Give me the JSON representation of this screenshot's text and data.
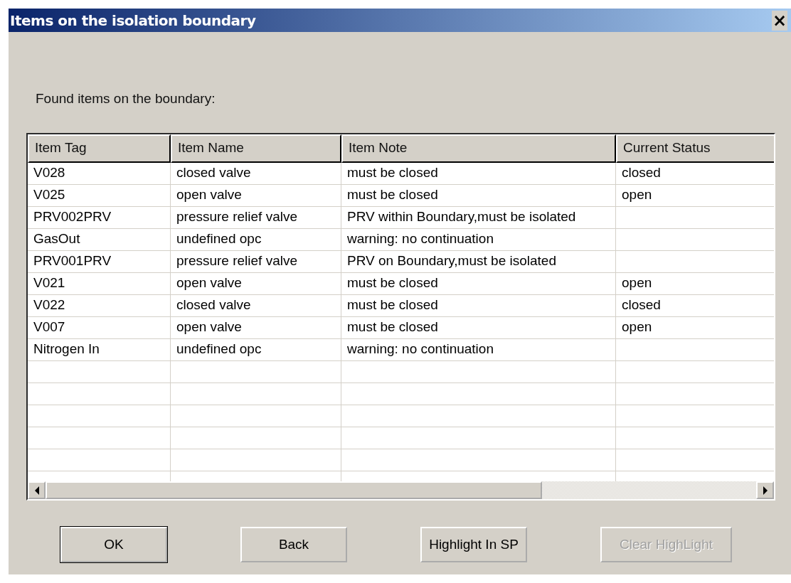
{
  "window": {
    "title": "Items on the isolation boundary",
    "close": "×"
  },
  "prompt": "Found items on the boundary:",
  "table": {
    "columns": [
      "Item Tag",
      "Item Name",
      "Item Note",
      "Current Status"
    ],
    "rows": [
      [
        "V028",
        "closed valve",
        "must be closed",
        "closed"
      ],
      [
        "V025",
        "open valve",
        "must be closed",
        "open"
      ],
      [
        "PRV002PRV",
        "pressure relief valve",
        "PRV within Boundary,must be isolated",
        ""
      ],
      [
        "GasOut",
        "undefined opc",
        "warning: no continuation",
        ""
      ],
      [
        "PRV001PRV",
        "pressure relief valve",
        "PRV on Boundary,must be isolated",
        ""
      ],
      [
        "V021",
        "open valve",
        "must be closed",
        "open"
      ],
      [
        "V022",
        "closed valve",
        "must be closed",
        "closed"
      ],
      [
        "V007",
        "open valve",
        "must be closed",
        "open"
      ],
      [
        "Nitrogen In",
        "undefined opc",
        "warning: no continuation",
        ""
      ]
    ]
  },
  "buttons": [
    {
      "label": "OK",
      "default": true,
      "disabled": false
    },
    {
      "label": "Back",
      "default": false,
      "disabled": false
    },
    {
      "label": "Highlight In SP",
      "default": false,
      "disabled": false
    },
    {
      "label": "Clear HighLight",
      "default": false,
      "disabled": true
    }
  ]
}
